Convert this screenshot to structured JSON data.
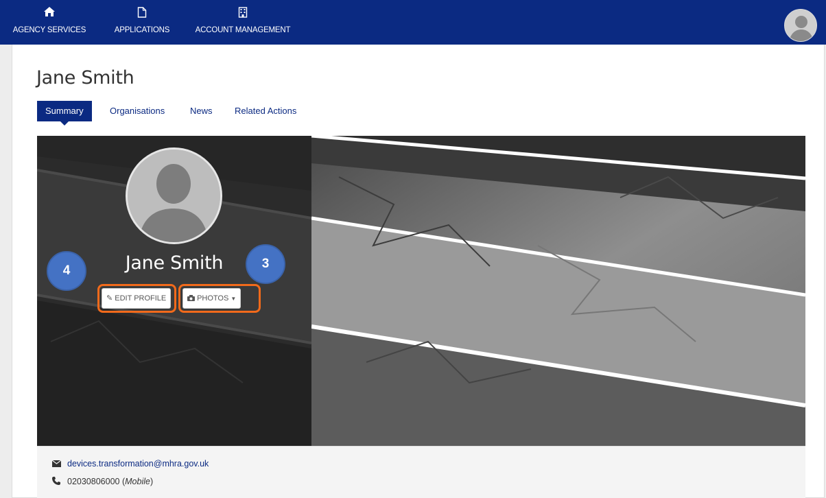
{
  "nav": {
    "items": [
      {
        "label": "AGENCY SERVICES",
        "icon": "home-icon"
      },
      {
        "label": "APPLICATIONS",
        "icon": "document-icon"
      },
      {
        "label": "ACCOUNT MANAGEMENT",
        "icon": "building-icon"
      }
    ],
    "avatar_icon": "user-avatar-icon"
  },
  "page": {
    "title": "Jane Smith",
    "tabs": [
      {
        "label": "Summary",
        "active": true
      },
      {
        "label": "Organisations",
        "active": false
      },
      {
        "label": "News",
        "active": false
      },
      {
        "label": "Related Actions",
        "active": false
      }
    ]
  },
  "profile": {
    "name": "Jane Smith",
    "edit_button": "EDIT PROFILE",
    "photos_button": "PHOTOS"
  },
  "annotations": {
    "badge_left": "4",
    "badge_right": "3",
    "highlight_color": "#f26a1b",
    "badge_color": "#4472c4"
  },
  "contact": {
    "email": "devices.transformation@mhra.gov.uk",
    "phone": "02030806000",
    "phone_type": "Mobile"
  },
  "colors": {
    "nav_bg": "#0b2a82",
    "accent": "#0b2a82"
  }
}
